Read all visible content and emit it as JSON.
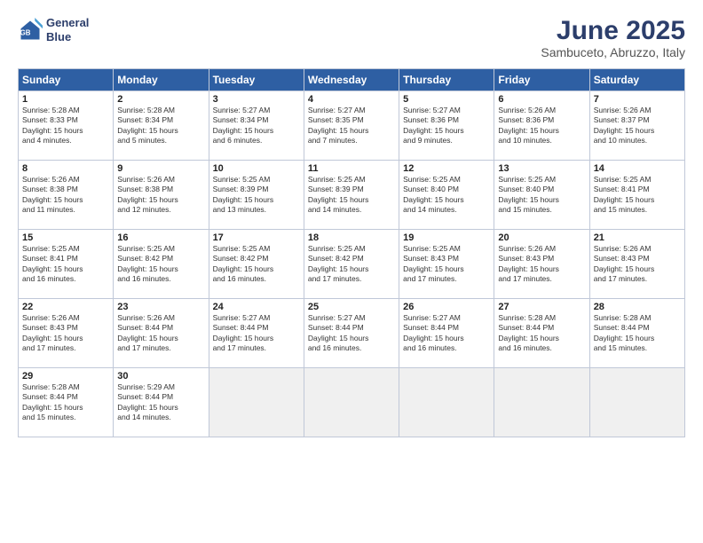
{
  "header": {
    "logo_line1": "General",
    "logo_line2": "Blue",
    "title": "June 2025",
    "subtitle": "Sambuceto, Abruzzo, Italy"
  },
  "columns": [
    "Sunday",
    "Monday",
    "Tuesday",
    "Wednesday",
    "Thursday",
    "Friday",
    "Saturday"
  ],
  "weeks": [
    [
      {
        "day": "1",
        "lines": [
          "Sunrise: 5:28 AM",
          "Sunset: 8:33 PM",
          "Daylight: 15 hours",
          "and 4 minutes."
        ]
      },
      {
        "day": "2",
        "lines": [
          "Sunrise: 5:28 AM",
          "Sunset: 8:34 PM",
          "Daylight: 15 hours",
          "and 5 minutes."
        ]
      },
      {
        "day": "3",
        "lines": [
          "Sunrise: 5:27 AM",
          "Sunset: 8:34 PM",
          "Daylight: 15 hours",
          "and 6 minutes."
        ]
      },
      {
        "day": "4",
        "lines": [
          "Sunrise: 5:27 AM",
          "Sunset: 8:35 PM",
          "Daylight: 15 hours",
          "and 7 minutes."
        ]
      },
      {
        "day": "5",
        "lines": [
          "Sunrise: 5:27 AM",
          "Sunset: 8:36 PM",
          "Daylight: 15 hours",
          "and 9 minutes."
        ]
      },
      {
        "day": "6",
        "lines": [
          "Sunrise: 5:26 AM",
          "Sunset: 8:36 PM",
          "Daylight: 15 hours",
          "and 10 minutes."
        ]
      },
      {
        "day": "7",
        "lines": [
          "Sunrise: 5:26 AM",
          "Sunset: 8:37 PM",
          "Daylight: 15 hours",
          "and 10 minutes."
        ]
      }
    ],
    [
      {
        "day": "8",
        "lines": [
          "Sunrise: 5:26 AM",
          "Sunset: 8:38 PM",
          "Daylight: 15 hours",
          "and 11 minutes."
        ]
      },
      {
        "day": "9",
        "lines": [
          "Sunrise: 5:26 AM",
          "Sunset: 8:38 PM",
          "Daylight: 15 hours",
          "and 12 minutes."
        ]
      },
      {
        "day": "10",
        "lines": [
          "Sunrise: 5:25 AM",
          "Sunset: 8:39 PM",
          "Daylight: 15 hours",
          "and 13 minutes."
        ]
      },
      {
        "day": "11",
        "lines": [
          "Sunrise: 5:25 AM",
          "Sunset: 8:39 PM",
          "Daylight: 15 hours",
          "and 14 minutes."
        ]
      },
      {
        "day": "12",
        "lines": [
          "Sunrise: 5:25 AM",
          "Sunset: 8:40 PM",
          "Daylight: 15 hours",
          "and 14 minutes."
        ]
      },
      {
        "day": "13",
        "lines": [
          "Sunrise: 5:25 AM",
          "Sunset: 8:40 PM",
          "Daylight: 15 hours",
          "and 15 minutes."
        ]
      },
      {
        "day": "14",
        "lines": [
          "Sunrise: 5:25 AM",
          "Sunset: 8:41 PM",
          "Daylight: 15 hours",
          "and 15 minutes."
        ]
      }
    ],
    [
      {
        "day": "15",
        "lines": [
          "Sunrise: 5:25 AM",
          "Sunset: 8:41 PM",
          "Daylight: 15 hours",
          "and 16 minutes."
        ]
      },
      {
        "day": "16",
        "lines": [
          "Sunrise: 5:25 AM",
          "Sunset: 8:42 PM",
          "Daylight: 15 hours",
          "and 16 minutes."
        ]
      },
      {
        "day": "17",
        "lines": [
          "Sunrise: 5:25 AM",
          "Sunset: 8:42 PM",
          "Daylight: 15 hours",
          "and 16 minutes."
        ]
      },
      {
        "day": "18",
        "lines": [
          "Sunrise: 5:25 AM",
          "Sunset: 8:42 PM",
          "Daylight: 15 hours",
          "and 17 minutes."
        ]
      },
      {
        "day": "19",
        "lines": [
          "Sunrise: 5:25 AM",
          "Sunset: 8:43 PM",
          "Daylight: 15 hours",
          "and 17 minutes."
        ]
      },
      {
        "day": "20",
        "lines": [
          "Sunrise: 5:26 AM",
          "Sunset: 8:43 PM",
          "Daylight: 15 hours",
          "and 17 minutes."
        ]
      },
      {
        "day": "21",
        "lines": [
          "Sunrise: 5:26 AM",
          "Sunset: 8:43 PM",
          "Daylight: 15 hours",
          "and 17 minutes."
        ]
      }
    ],
    [
      {
        "day": "22",
        "lines": [
          "Sunrise: 5:26 AM",
          "Sunset: 8:43 PM",
          "Daylight: 15 hours",
          "and 17 minutes."
        ]
      },
      {
        "day": "23",
        "lines": [
          "Sunrise: 5:26 AM",
          "Sunset: 8:44 PM",
          "Daylight: 15 hours",
          "and 17 minutes."
        ]
      },
      {
        "day": "24",
        "lines": [
          "Sunrise: 5:27 AM",
          "Sunset: 8:44 PM",
          "Daylight: 15 hours",
          "and 17 minutes."
        ]
      },
      {
        "day": "25",
        "lines": [
          "Sunrise: 5:27 AM",
          "Sunset: 8:44 PM",
          "Daylight: 15 hours",
          "and 16 minutes."
        ]
      },
      {
        "day": "26",
        "lines": [
          "Sunrise: 5:27 AM",
          "Sunset: 8:44 PM",
          "Daylight: 15 hours",
          "and 16 minutes."
        ]
      },
      {
        "day": "27",
        "lines": [
          "Sunrise: 5:28 AM",
          "Sunset: 8:44 PM",
          "Daylight: 15 hours",
          "and 16 minutes."
        ]
      },
      {
        "day": "28",
        "lines": [
          "Sunrise: 5:28 AM",
          "Sunset: 8:44 PM",
          "Daylight: 15 hours",
          "and 15 minutes."
        ]
      }
    ],
    [
      {
        "day": "29",
        "lines": [
          "Sunrise: 5:28 AM",
          "Sunset: 8:44 PM",
          "Daylight: 15 hours",
          "and 15 minutes."
        ]
      },
      {
        "day": "30",
        "lines": [
          "Sunrise: 5:29 AM",
          "Sunset: 8:44 PM",
          "Daylight: 15 hours",
          "and 14 minutes."
        ]
      },
      {
        "day": "",
        "lines": []
      },
      {
        "day": "",
        "lines": []
      },
      {
        "day": "",
        "lines": []
      },
      {
        "day": "",
        "lines": []
      },
      {
        "day": "",
        "lines": []
      }
    ]
  ]
}
